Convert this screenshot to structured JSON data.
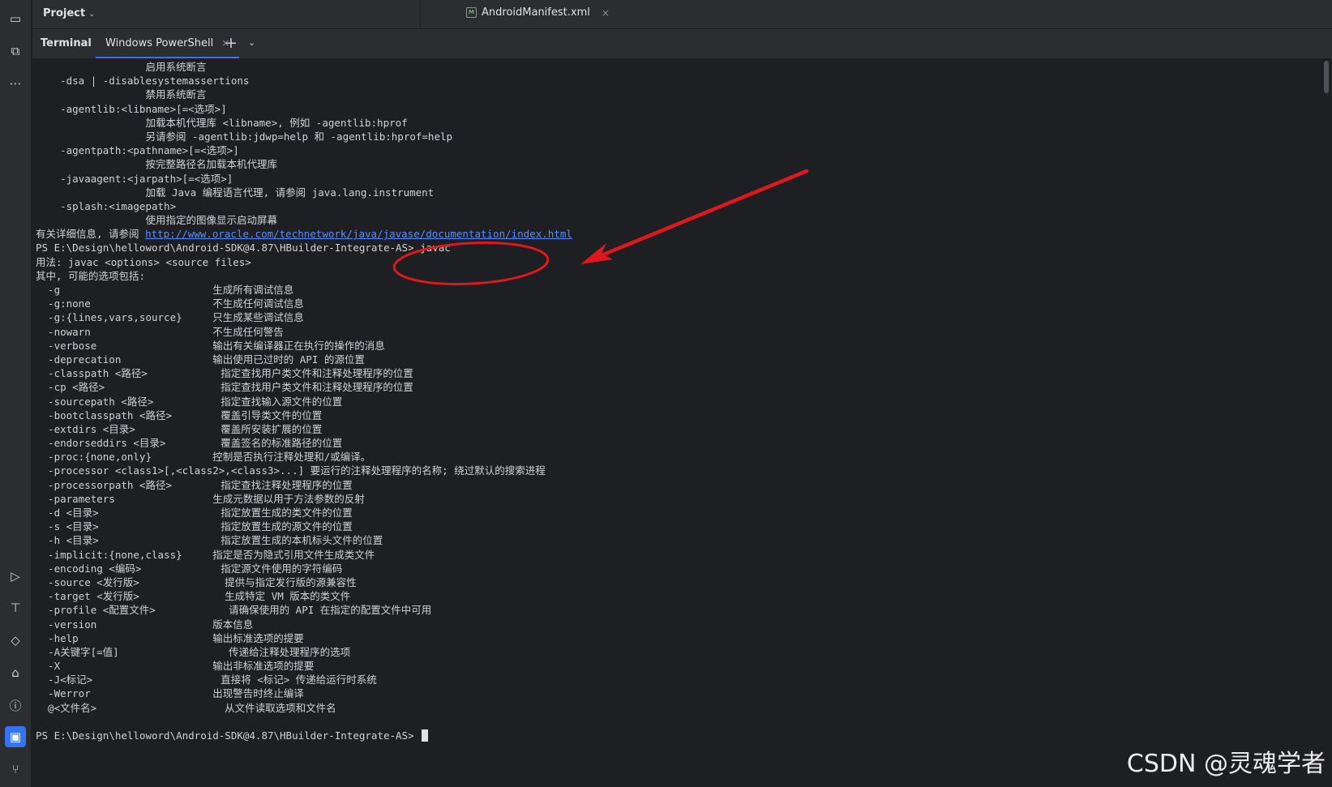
{
  "colors": {
    "accent": "#3574f0",
    "annotation": "#e0181e",
    "link": "#5c8dff",
    "background": "#1e1f22",
    "panel": "#2b2d30"
  },
  "sidebar": {
    "top_icons": [
      {
        "name": "folder-icon",
        "glyph": "▭"
      },
      {
        "name": "structure-icon",
        "glyph": "⧉"
      },
      {
        "name": "more-icon",
        "glyph": "⋯"
      }
    ],
    "bottom_icons": [
      {
        "name": "run-icon",
        "glyph": "▷"
      },
      {
        "name": "build-icon",
        "glyph": "⊤"
      },
      {
        "name": "gem-icon",
        "glyph": "◇"
      },
      {
        "name": "device-icon",
        "glyph": "⌂"
      },
      {
        "name": "problems-icon",
        "glyph": "ⓘ"
      },
      {
        "name": "terminal-icon",
        "glyph": "▣",
        "active": true
      },
      {
        "name": "git-icon",
        "glyph": "⑂"
      }
    ]
  },
  "header": {
    "project_label": "Project",
    "project_chevron": "⌄"
  },
  "editor": {
    "tab_label": "AndroidManifest.xml",
    "tab_close": "×"
  },
  "terminal": {
    "title": "Terminal",
    "tab_label": "Windows PowerShell",
    "tab_close": "×",
    "add_icon": "+",
    "menu_icon": "⌄",
    "lines": [
      "                  启用系统断言",
      "    -dsa | -disablesystemassertions",
      "                  禁用系统断言",
      "    -agentlib:<libname>[=<选项>]",
      "                  加载本机代理库 <libname>, 例如 -agentlib:hprof",
      "                  另请参阅 -agentlib:jdwp=help 和 -agentlib:hprof=help",
      "    -agentpath:<pathname>[=<选项>]",
      "                  按完整路径名加载本机代理库",
      "    -javaagent:<jarpath>[=<选项>]",
      "                  加载 Java 编程语言代理, 请参阅 java.lang.instrument",
      "    -splash:<imagepath>",
      "                  使用指定的图像显示启动屏幕",
      "",
      "PS E:\\Design\\helloword\\Android-SDK@4.87\\HBuilder-Integrate-AS> javac",
      "用法: javac <options> <source files>",
      "其中, 可能的选项包括:",
      "  -g                         生成所有调试信息",
      "  -g:none                    不生成任何调试信息",
      "  -g:{lines,vars,source}     只生成某些调试信息",
      "  -nowarn                    不生成任何警告",
      "  -verbose                   输出有关编译器正在执行的操作的消息",
      "  -deprecation               输出使用已过时的 API 的源位置",
      "  -classpath <路径>            指定查找用户类文件和注释处理程序的位置",
      "  -cp <路径>                   指定查找用户类文件和注释处理程序的位置",
      "  -sourcepath <路径>           指定查找输入源文件的位置",
      "  -bootclasspath <路径>        覆盖引导类文件的位置",
      "  -extdirs <目录>              覆盖所安装扩展的位置",
      "  -endorseddirs <目录>         覆盖签名的标准路径的位置",
      "  -proc:{none,only}          控制是否执行注释处理和/或编译。",
      "  -processor <class1>[,<class2>,<class3>...] 要运行的注释处理程序的名称; 绕过默认的搜索进程",
      "  -processorpath <路径>        指定查找注释处理程序的位置",
      "  -parameters                生成元数据以用于方法参数的反射",
      "  -d <目录>                    指定放置生成的类文件的位置",
      "  -s <目录>                    指定放置生成的源文件的位置",
      "  -h <目录>                    指定放置生成的本机标头文件的位置",
      "  -implicit:{none,class}     指定是否为隐式引用文件生成类文件",
      "  -encoding <编码>             指定源文件使用的字符编码",
      "  -source <发行版>              提供与指定发行版的源兼容性",
      "  -target <发行版>              生成特定 VM 版本的类文件",
      "  -profile <配置文件>            请确保使用的 API 在指定的配置文件中可用",
      "  -version                   版本信息",
      "  -help                      输出标准选项的提要",
      "  -A关键字[=值]                  传递给注释处理程序的选项",
      "  -X                         输出非标准选项的提要",
      "  -J<标记>                     直接将 <标记> 传递给运行时系统",
      "  -Werror                    出现警告时终止编译",
      "  @<文件名>                     从文件读取选项和文件名",
      "",
      "PS E:\\Design\\helloword\\Android-SDK@4.87\\HBuilder-Integrate-AS> "
    ],
    "info_prefix": "有关详细信息, 请参阅 ",
    "info_link": "http://www.oracle.com/technetwork/java/javase/documentation/index.html"
  },
  "watermark": "CSDN @灵魂学者"
}
